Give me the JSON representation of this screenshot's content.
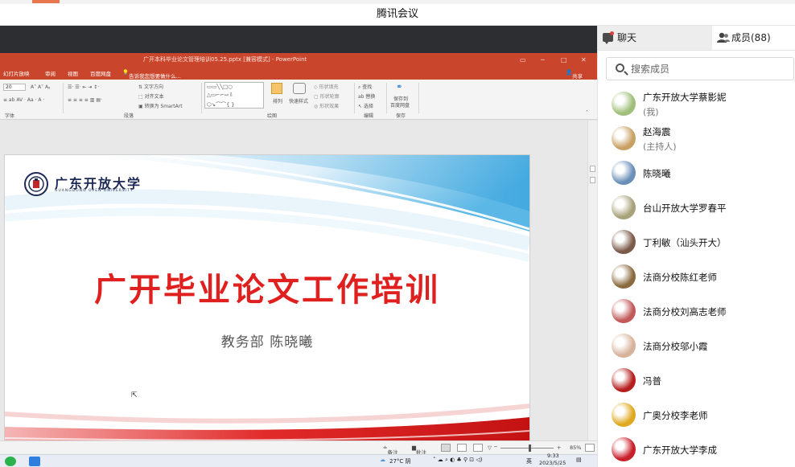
{
  "app": {
    "title": "腾讯会议"
  },
  "ppt": {
    "window_title": "广开本科毕业论文管理培训05.25.pptx [兼容模式] - PowerPoint",
    "tabs": [
      "幻灯片放映",
      "审阅",
      "视图",
      "百度网盘"
    ],
    "tell_me": "告诉我您想要做什么...",
    "share": "共享",
    "font_size": "20",
    "ribbon": {
      "text_direction": "文字方向",
      "align_text": "对齐文本",
      "smartart": "转换为 SmartArt",
      "shape_fill": "形状填充",
      "shape_outline": "形状轮廓",
      "shape_effect": "形状效果",
      "arrange": "排列",
      "quick_styles": "快速样式",
      "find": "查找",
      "replace": "替换",
      "select": "选择",
      "save_to": "保存到",
      "baidu_disk": "百度网盘",
      "groups": {
        "font": "字体",
        "paragraph": "段落",
        "drawing": "绘图",
        "editing": "编辑",
        "save": "保存"
      }
    },
    "slide": {
      "school_name": "广东开放大学",
      "school_name_en": "GUANGDONG OPEN UNIVERSITY",
      "title": "广开毕业论文工作培训",
      "subtitle": "教务部  陈晓曦"
    },
    "status": {
      "notes": "备注",
      "comments": "批注",
      "zoom": "85%",
      "zoom_level": 0.55
    }
  },
  "taskbar": {
    "weather": "27°C 阴",
    "ime": "英",
    "time": "9:33",
    "date": "2023/5/25"
  },
  "panel": {
    "tab_chat": "聊天",
    "tab_members": "成员(88)",
    "search_placeholder": "搜索成员",
    "members": [
      {
        "name": "广东开放大学蔡影妮",
        "sub": "(我)",
        "avatar_color": "#9fbf7a"
      },
      {
        "name": "赵海震",
        "sub": "(主持人)",
        "avatar_color": "#c9a064"
      },
      {
        "name": "陈晓曦",
        "avatar_color": "#6a8fb8"
      },
      {
        "name": " 台山开放大学罗春平",
        "avatar_color": "#a8a27a"
      },
      {
        "name": "丁利敏（汕头开大）",
        "avatar_color": "#7b5a4a"
      },
      {
        "name": "法商分校陈红老师",
        "avatar_color": "#8a6a3e"
      },
      {
        "name": "法商分校刘高志老师",
        "avatar_color": "#c25a5a"
      },
      {
        "name": "法商分校邬小霞",
        "avatar_color": "#d8b39c"
      },
      {
        "name": "冯普",
        "avatar_color": "#b71f1f"
      },
      {
        "name": "广奥分校李老师",
        "avatar_color": "#e0a81f"
      },
      {
        "name": "广东开放大学李成",
        "avatar_color": "#c81f2a"
      }
    ]
  }
}
